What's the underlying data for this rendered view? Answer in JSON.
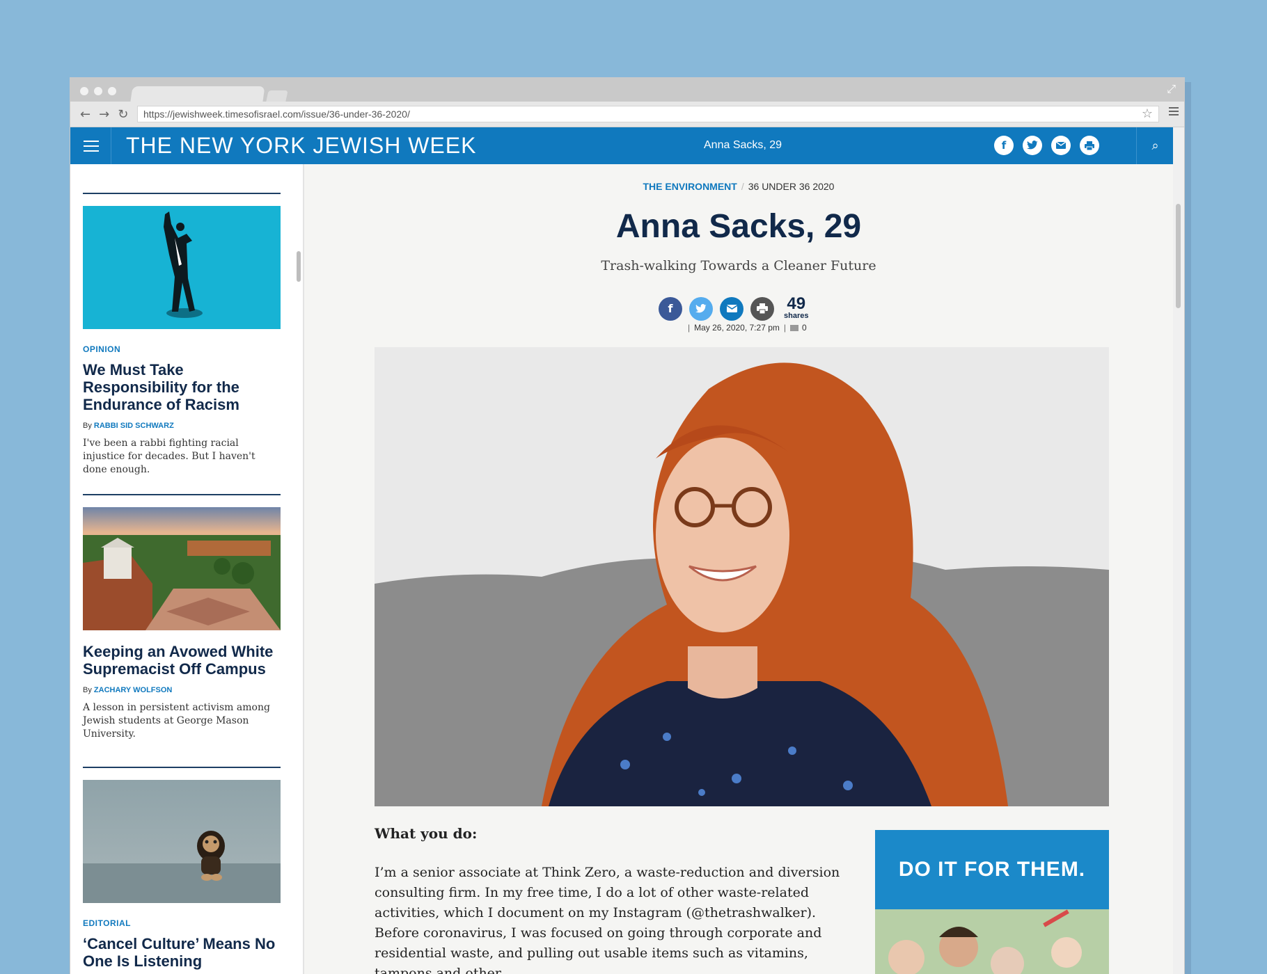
{
  "browser": {
    "url": "https://jewishweek.timesofisrael.com/issue/36-under-36-2020/"
  },
  "header": {
    "logo": "THE NEW YORK JEWISH WEEK",
    "article_title": "Anna Sacks, 29",
    "share_icons": [
      "facebook-icon",
      "twitter-icon",
      "email-icon",
      "print-icon"
    ]
  },
  "sidebar": {
    "cards": [
      {
        "kicker": "OPINION",
        "title": "We Must Take Responsibility for the Endurance of Racism",
        "by": "By",
        "author": "RABBI SID SCHWARZ",
        "excerpt": "I've been a rabbi fighting racial injustice for decades. But I haven't done enough."
      },
      {
        "kicker": "",
        "title": "Keeping an Avowed White Supremacist Off Campus",
        "by": "By",
        "author": "ZACHARY WOLFSON",
        "excerpt": "A lesson in persistent activism among Jewish students at George Mason University."
      },
      {
        "kicker": "EDITORIAL",
        "title": "‘Cancel Culture’ Means No One Is Listening",
        "by": "",
        "author": "",
        "excerpt": ""
      }
    ]
  },
  "article": {
    "category": "THE ENVIRONMENT",
    "subcategory": "36 UNDER 36 2020",
    "headline": "Anna Sacks, 29",
    "dek": "Trash-walking Towards a Cleaner Future",
    "shares": "49",
    "shares_label": "shares",
    "date": "May 26, 2020, 7:27 pm",
    "comments": "0",
    "question": "What you do:",
    "answer": "I’m a senior associate at Think Zero, a waste-reduction and diversion consulting firm. In my free time, I do a lot of other waste-related activities, which I document on my Instagram (@thetrashwalker). Before coronavirus, I was focused on going through corporate and residential waste, and pulling out usable items such as vitamins, tampons and other"
  },
  "ad": {
    "headline": "DO IT FOR THEM."
  },
  "colors": {
    "brand_blue": "#1079be",
    "navy": "#11294a",
    "facebook": "#3b5998",
    "twitter": "#55acee",
    "email": "#1079be",
    "print": "#555555"
  }
}
